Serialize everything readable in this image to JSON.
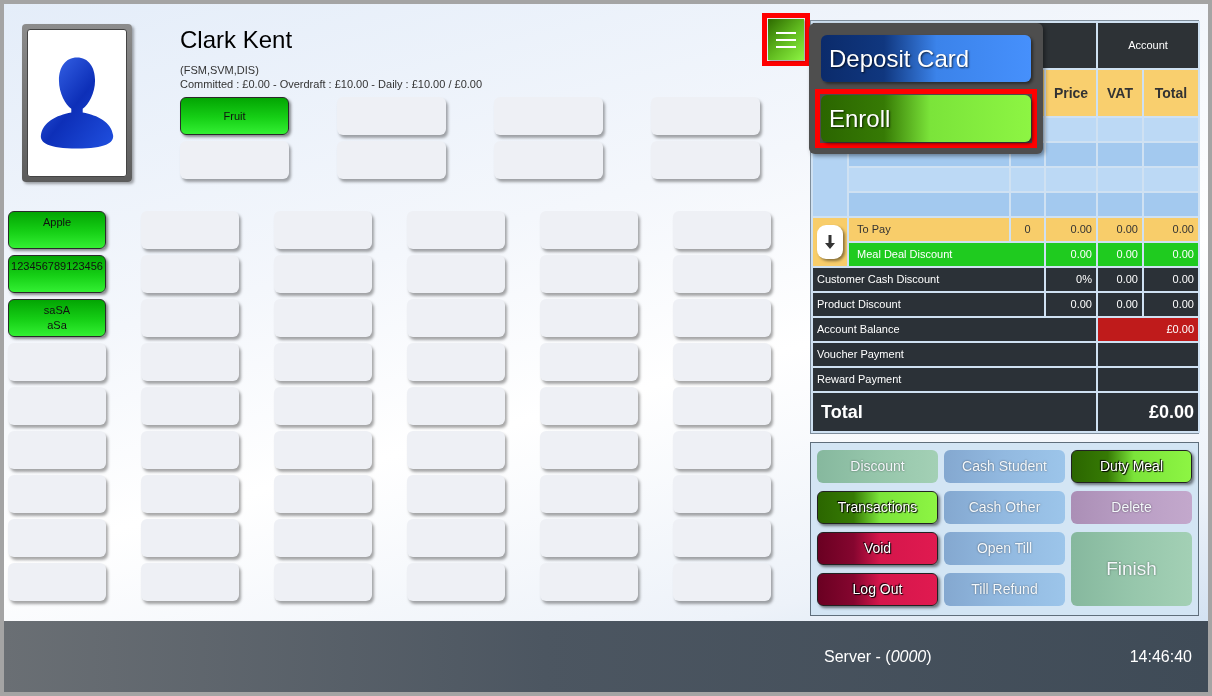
{
  "profile": {
    "name": "Clark Kent",
    "tags": "(FSM,SVM,DIS)",
    "summary": "Committed : £0.00 - Overdraft : £10.00 - Daily : £10.00 / £0.00"
  },
  "categories": [
    {
      "kind": "category",
      "label": "Fruit"
    },
    {
      "kind": "empty"
    },
    {
      "kind": "empty"
    },
    {
      "kind": "empty"
    },
    {
      "kind": "empty"
    },
    {
      "kind": "empty"
    },
    {
      "kind": "empty"
    },
    {
      "kind": "empty"
    }
  ],
  "menu_button": {
    "highlighted": true
  },
  "menu": {
    "items": [
      {
        "label": "Deposit Card",
        "kind": "blue",
        "highlighted": false
      },
      {
        "label": "Enroll",
        "kind": "green",
        "highlighted": true
      }
    ]
  },
  "products": [
    {
      "kind": "product",
      "label": "Apple"
    },
    {
      "kind": "empty"
    },
    {
      "kind": "empty"
    },
    {
      "kind": "empty"
    },
    {
      "kind": "empty"
    },
    {
      "kind": "empty"
    },
    {
      "kind": "product",
      "label": "123456789123456"
    },
    {
      "kind": "empty"
    },
    {
      "kind": "empty"
    },
    {
      "kind": "empty"
    },
    {
      "kind": "empty"
    },
    {
      "kind": "empty"
    },
    {
      "kind": "product",
      "label": "saSA\naSa"
    },
    {
      "kind": "empty"
    },
    {
      "kind": "empty"
    },
    {
      "kind": "empty"
    },
    {
      "kind": "empty"
    },
    {
      "kind": "empty"
    },
    {
      "kind": "empty"
    },
    {
      "kind": "empty"
    },
    {
      "kind": "empty"
    },
    {
      "kind": "empty"
    },
    {
      "kind": "empty"
    },
    {
      "kind": "empty"
    },
    {
      "kind": "empty"
    },
    {
      "kind": "empty"
    },
    {
      "kind": "empty"
    },
    {
      "kind": "empty"
    },
    {
      "kind": "empty"
    },
    {
      "kind": "empty"
    },
    {
      "kind": "empty"
    },
    {
      "kind": "empty"
    },
    {
      "kind": "empty"
    },
    {
      "kind": "empty"
    },
    {
      "kind": "empty"
    },
    {
      "kind": "empty"
    },
    {
      "kind": "empty"
    },
    {
      "kind": "empty"
    },
    {
      "kind": "empty"
    },
    {
      "kind": "empty"
    },
    {
      "kind": "empty"
    },
    {
      "kind": "empty"
    },
    {
      "kind": "empty"
    },
    {
      "kind": "empty"
    },
    {
      "kind": "empty"
    },
    {
      "kind": "empty"
    },
    {
      "kind": "empty"
    },
    {
      "kind": "empty"
    },
    {
      "kind": "empty"
    },
    {
      "kind": "empty"
    },
    {
      "kind": "empty"
    },
    {
      "kind": "empty"
    },
    {
      "kind": "empty"
    },
    {
      "kind": "empty"
    }
  ],
  "order_table": {
    "header": {
      "account": "Account",
      "columns": [
        "Price",
        "VAT",
        "Total"
      ]
    },
    "rows": [
      {
        "kind": "blank"
      },
      {
        "kind": "blank"
      },
      {
        "kind": "blank"
      },
      {
        "kind": "blank"
      },
      {
        "kind": "to_pay",
        "label": "To Pay",
        "qty": "0",
        "price": "0.00",
        "vat": "0.00",
        "total": "0.00"
      },
      {
        "kind": "meal_deal",
        "label": "Meal Deal Discount",
        "price": "0.00",
        "vat": "0.00",
        "total": "0.00"
      },
      {
        "kind": "discount",
        "label": "Customer Cash Discount",
        "price": "0%",
        "vat": "0.00",
        "total": "0.00"
      },
      {
        "kind": "discount",
        "label": "Product Discount",
        "price": "0.00",
        "vat": "0.00",
        "total": "0.00"
      },
      {
        "kind": "balance",
        "label": "Account Balance",
        "value": "£0.00"
      },
      {
        "kind": "payment",
        "label": "Voucher Payment"
      },
      {
        "kind": "payment",
        "label": "Reward Payment"
      },
      {
        "kind": "total",
        "label": "Total",
        "value": "£0.00"
      }
    ]
  },
  "actions": [
    {
      "label": "Discount",
      "kind": "green",
      "disabled": true
    },
    {
      "label": "Cash Student",
      "kind": "blue",
      "disabled": true
    },
    {
      "label": "Duty Meal",
      "kind": "green",
      "disabled": false
    },
    {
      "label": "Transactions",
      "kind": "green",
      "disabled": false
    },
    {
      "label": "Cash Other",
      "kind": "blue",
      "disabled": true
    },
    {
      "label": "Delete",
      "kind": "red",
      "disabled": true
    },
    {
      "label": "Void",
      "kind": "red",
      "disabled": false
    },
    {
      "label": "Open Till",
      "kind": "blue",
      "disabled": true
    },
    {
      "label": "Finish",
      "kind": "finish",
      "disabled": true
    },
    {
      "label": "Log Out",
      "kind": "red",
      "disabled": false
    },
    {
      "label": "Till Refund",
      "kind": "blue",
      "disabled": true
    }
  ],
  "status_bar": {
    "server": "Server - (*0000*)",
    "time": "14:46:40"
  }
}
